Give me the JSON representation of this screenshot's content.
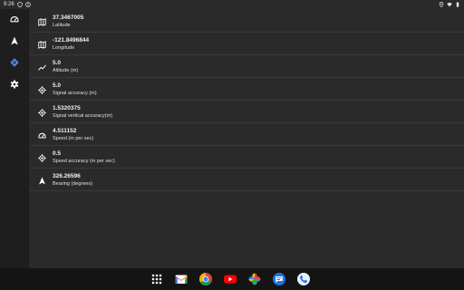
{
  "status_bar": {
    "time": "9:26",
    "left_icons": [
      "shield-icon",
      "alert-icon"
    ],
    "right_icons": [
      "location-icon",
      "wifi-icon",
      "battery-icon"
    ]
  },
  "nav_rail": {
    "items": [
      {
        "name": "speedometer-icon",
        "selected": false
      },
      {
        "name": "navigation-arrow-icon",
        "selected": false
      },
      {
        "name": "gps-fixed-icon",
        "selected": true
      },
      {
        "name": "settings-icon",
        "selected": false
      }
    ],
    "accent_color": "#5b8cff"
  },
  "rows": [
    {
      "icon": "map-icon",
      "value": "37.3467005",
      "label": "Latitude"
    },
    {
      "icon": "map-icon",
      "value": "-121.8496844",
      "label": "Longitude"
    },
    {
      "icon": "trending-up-icon",
      "value": "5.0",
      "label": "Altitude (m)"
    },
    {
      "icon": "gps-fixed-icon",
      "value": "5.0",
      "label": "Signal accuracy (m)"
    },
    {
      "icon": "gps-fixed-icon",
      "value": "1.5320375",
      "label": "Signal vertical accuracy(m)"
    },
    {
      "icon": "speedometer-icon",
      "value": "4.511152",
      "label": "Speed (m per sec)"
    },
    {
      "icon": "gps-fixed-icon",
      "value": "0.5",
      "label": "Speed accuracy (m per sec)"
    },
    {
      "icon": "navigation-arrow-icon",
      "value": "326.26596",
      "label": "Bearing (degrees)"
    }
  ],
  "taskbar": {
    "apps": [
      "app-drawer-icon",
      "gmail-icon",
      "chrome-icon",
      "youtube-icon",
      "photos-icon",
      "messages-icon",
      "phone-icon"
    ]
  }
}
